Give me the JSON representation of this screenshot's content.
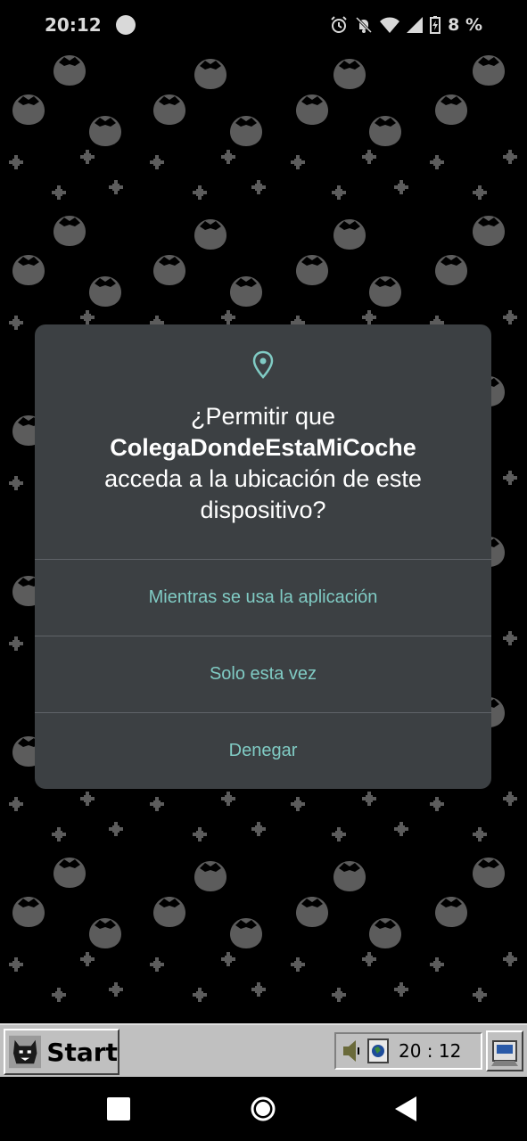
{
  "status_bar": {
    "time": "20:12",
    "battery": "8 %",
    "icons": [
      "alarm-icon",
      "notifications-off-icon",
      "wifi-icon",
      "signal-icon",
      "battery-charging-icon"
    ]
  },
  "dialog": {
    "icon": "location-pin-icon",
    "title_prefix": "¿Permitir que",
    "app_name": "ColegaDondeEstaMiCoche",
    "title_suffix": "acceda a la ubicación de este dispositivo?",
    "options": [
      "Mientras se usa la aplicación",
      "Solo esta vez",
      "Denegar"
    ],
    "accent": "#80cbc4",
    "background": "#3c4043"
  },
  "taskbar": {
    "start_label": "Start",
    "clock": "20 : 12",
    "icons": [
      "speaker-icon",
      "globe-icon",
      "app-tray-icon"
    ]
  },
  "nav_bar": {
    "icons": [
      "recents-square-icon",
      "home-circle-icon",
      "back-triangle-icon"
    ]
  }
}
